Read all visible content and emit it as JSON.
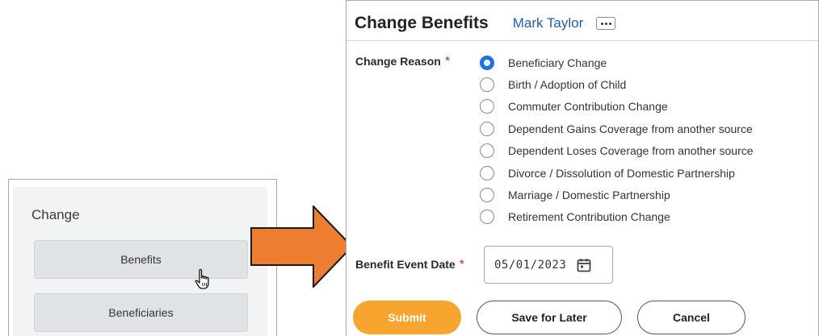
{
  "left_card": {
    "title": "Change",
    "buttons": [
      {
        "label": "Benefits"
      },
      {
        "label": "Beneficiaries"
      }
    ]
  },
  "panel": {
    "title": "Change Benefits",
    "user": "Mark Taylor",
    "more_icon": "more-dots-icon",
    "change_reason": {
      "label": "Change Reason",
      "required_mark": "*",
      "selected_index": 0,
      "options": [
        {
          "label": "Beneficiary Change"
        },
        {
          "label": "Birth / Adoption of Child"
        },
        {
          "label": "Commuter Contribution Change"
        },
        {
          "label": "Dependent Gains Coverage from another source"
        },
        {
          "label": "Dependent Loses Coverage from another source"
        },
        {
          "label": "Divorce / Dissolution of Domestic Partnership"
        },
        {
          "label": "Marriage / Domestic Partnership"
        },
        {
          "label": "Retirement Contribution Change"
        }
      ]
    },
    "benefit_event_date": {
      "label": "Benefit Event Date",
      "required_mark": "*",
      "value": "05/01/2023",
      "icon": "calendar-icon"
    },
    "actions": {
      "submit_label": "Submit",
      "save_label": "Save for Later",
      "cancel_label": "Cancel"
    }
  },
  "colors": {
    "accent_orange": "#f7a52f",
    "arrow_orange": "#ed7d31",
    "link_blue": "#1f5fa8",
    "radio_selected": "#1a73e8",
    "required_red": "#d3262c"
  }
}
